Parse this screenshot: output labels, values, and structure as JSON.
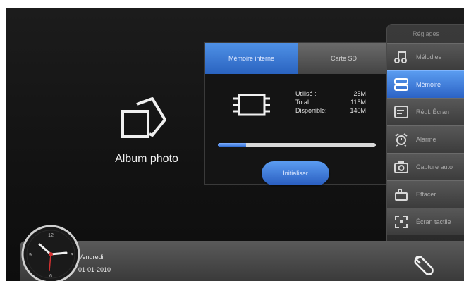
{
  "album": {
    "label": "Album photo"
  },
  "memory": {
    "tabs": [
      {
        "label": "Mémoire interne",
        "active": true
      },
      {
        "label": "Carte SD",
        "active": false
      }
    ],
    "stats": [
      {
        "label": "Utilisé :",
        "value": "25M"
      },
      {
        "label": "Total:",
        "value": "115M"
      },
      {
        "label": "Disponible:",
        "value": "140M"
      }
    ],
    "usage_fraction": 0.18,
    "init_button": "Initialiser"
  },
  "sidebar": {
    "title": "Réglages",
    "items": [
      {
        "label": "Mélodies",
        "icon": "music-note-icon",
        "active": false
      },
      {
        "label": "Mémoire",
        "icon": "memory-icon",
        "active": true
      },
      {
        "label": "Régl. Écran",
        "icon": "screen-settings-icon",
        "active": false
      },
      {
        "label": "Alarme",
        "icon": "alarm-icon",
        "active": false
      },
      {
        "label": "Capture auto",
        "icon": "camera-icon",
        "active": false
      },
      {
        "label": "Effacer",
        "icon": "erase-icon",
        "active": false
      },
      {
        "label": "Écran tactile",
        "icon": "touchscreen-icon",
        "active": false
      }
    ]
  },
  "status": {
    "day": "Vendredi",
    "date": "01-01-2010"
  },
  "clock": {
    "numbers": [
      "12",
      "3",
      "6",
      "9"
    ]
  },
  "colors": {
    "accent": "#2f6bd1",
    "background": "#141414"
  }
}
